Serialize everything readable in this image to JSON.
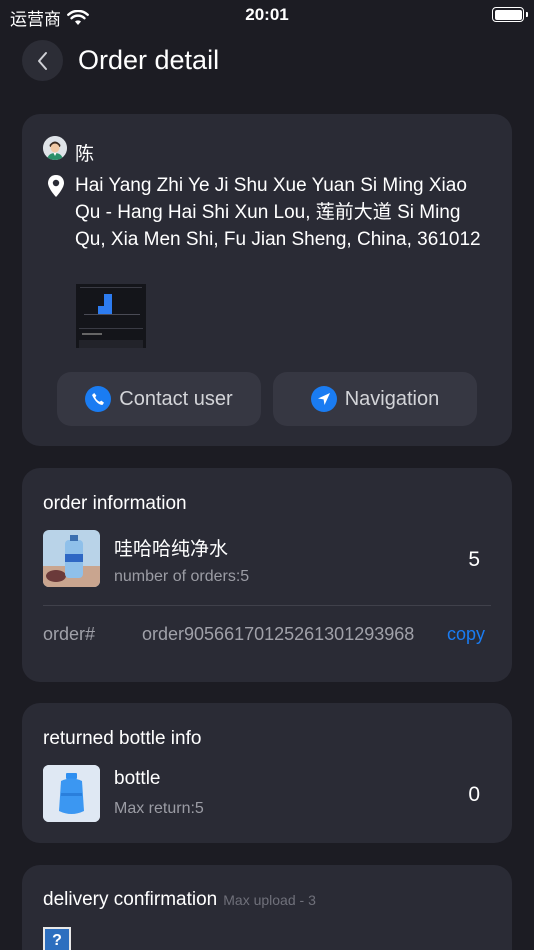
{
  "status_bar": {
    "carrier": "运营商",
    "time": "20:01"
  },
  "header": {
    "title": "Order detail"
  },
  "user": {
    "name": "陈",
    "address": "Hai Yang Zhi Ye Ji Shu Xue Yuan Si Ming Xiao Qu - Hang Hai Shi Xun Lou, 莲前大道 Si Ming Qu, Xia Men Shi, Fu Jian Sheng, China, 361012",
    "contact_label": "Contact user",
    "navigation_label": "Navigation"
  },
  "order_info": {
    "title": "order information",
    "product_name": "哇哈哈纯净水",
    "product_sub": "number of orders:5",
    "count": "5",
    "order_label": "order#",
    "order_number": "order905661701252613012939​68",
    "copy_label": "copy"
  },
  "bottle_info": {
    "title": "returned bottle info",
    "name": "bottle",
    "sub": "Max return:5",
    "count": "0"
  },
  "delivery": {
    "title": "delivery confirmation",
    "max_upload": "Max upload - 3",
    "upload_glyph": "?"
  },
  "colors": {
    "background": "#1c1c23",
    "card": "#2a2b35",
    "accent": "#1a7cf2"
  },
  "icons": [
    "back-icon",
    "wifi-icon",
    "battery-icon",
    "location-pin-icon",
    "phone-icon",
    "navigation-arrow-icon"
  ]
}
